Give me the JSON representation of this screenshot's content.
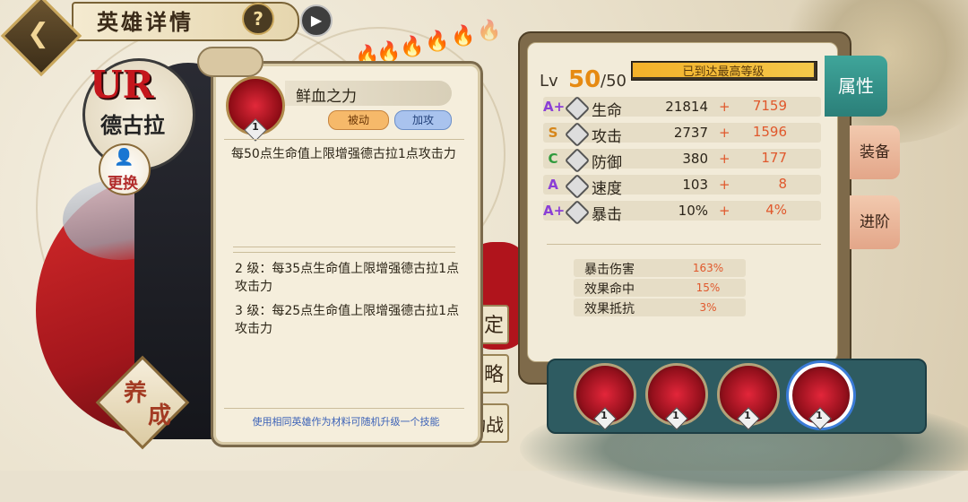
{
  "header": {
    "title": "英雄详情",
    "help_icon": "?",
    "play_icon": "▶",
    "back_icon": "❮"
  },
  "hero": {
    "rarity": "UR",
    "name": "德古拉",
    "swap_label": "更换",
    "nurture_label_1": "养",
    "nurture_label_2": "成"
  },
  "side_buttons": [
    "定",
    "略",
    "动战"
  ],
  "skill": {
    "name": "鲜血之力",
    "level": "1",
    "tags": [
      "被动",
      "加攻"
    ],
    "description": "每50点生命值上限增强德古拉1点攻击力",
    "upgrades": [
      "2 级：每35点生命值上限增强德古拉1点攻击力",
      "3 级：每25点生命值上限增强德古拉1点攻击力"
    ],
    "footer": "使用相同英雄作为材料可随机升级一个技能"
  },
  "level": {
    "label": "Lv",
    "current": "50",
    "max": "/50",
    "status": "已到达最高等级"
  },
  "stats": [
    {
      "grade": "A+",
      "grade_color": "#8b3fd6",
      "name": "生命",
      "base": "21814",
      "plus": "+",
      "bonus": "7159"
    },
    {
      "grade": "S",
      "grade_color": "#d6861a",
      "name": "攻击",
      "base": "2737",
      "plus": "+",
      "bonus": "1596"
    },
    {
      "grade": "C",
      "grade_color": "#2f9a3c",
      "name": "防御",
      "base": "380",
      "plus": "+",
      "bonus": "177"
    },
    {
      "grade": "A",
      "grade_color": "#8b3fd6",
      "name": "速度",
      "base": "103",
      "plus": "+",
      "bonus": "8"
    },
    {
      "grade": "A+",
      "grade_color": "#8b3fd6",
      "name": "暴击",
      "base": "10%",
      "plus": "+",
      "bonus": "4%"
    }
  ],
  "sub_stats": [
    {
      "name": "暴击伤害",
      "value": "163%"
    },
    {
      "name": "效果命中",
      "value": "15%"
    },
    {
      "name": "效果抵抗",
      "value": "3%"
    }
  ],
  "tabs": [
    "属性",
    "装备",
    "进阶"
  ],
  "skill_slots": [
    {
      "level": "1",
      "selected": false
    },
    {
      "level": "1",
      "selected": false
    },
    {
      "level": "1",
      "selected": false
    },
    {
      "level": "1",
      "selected": true
    }
  ],
  "colors": {
    "accent": "#e68a12",
    "tab_active": "#2b7f79",
    "flame": "#b542e8"
  }
}
